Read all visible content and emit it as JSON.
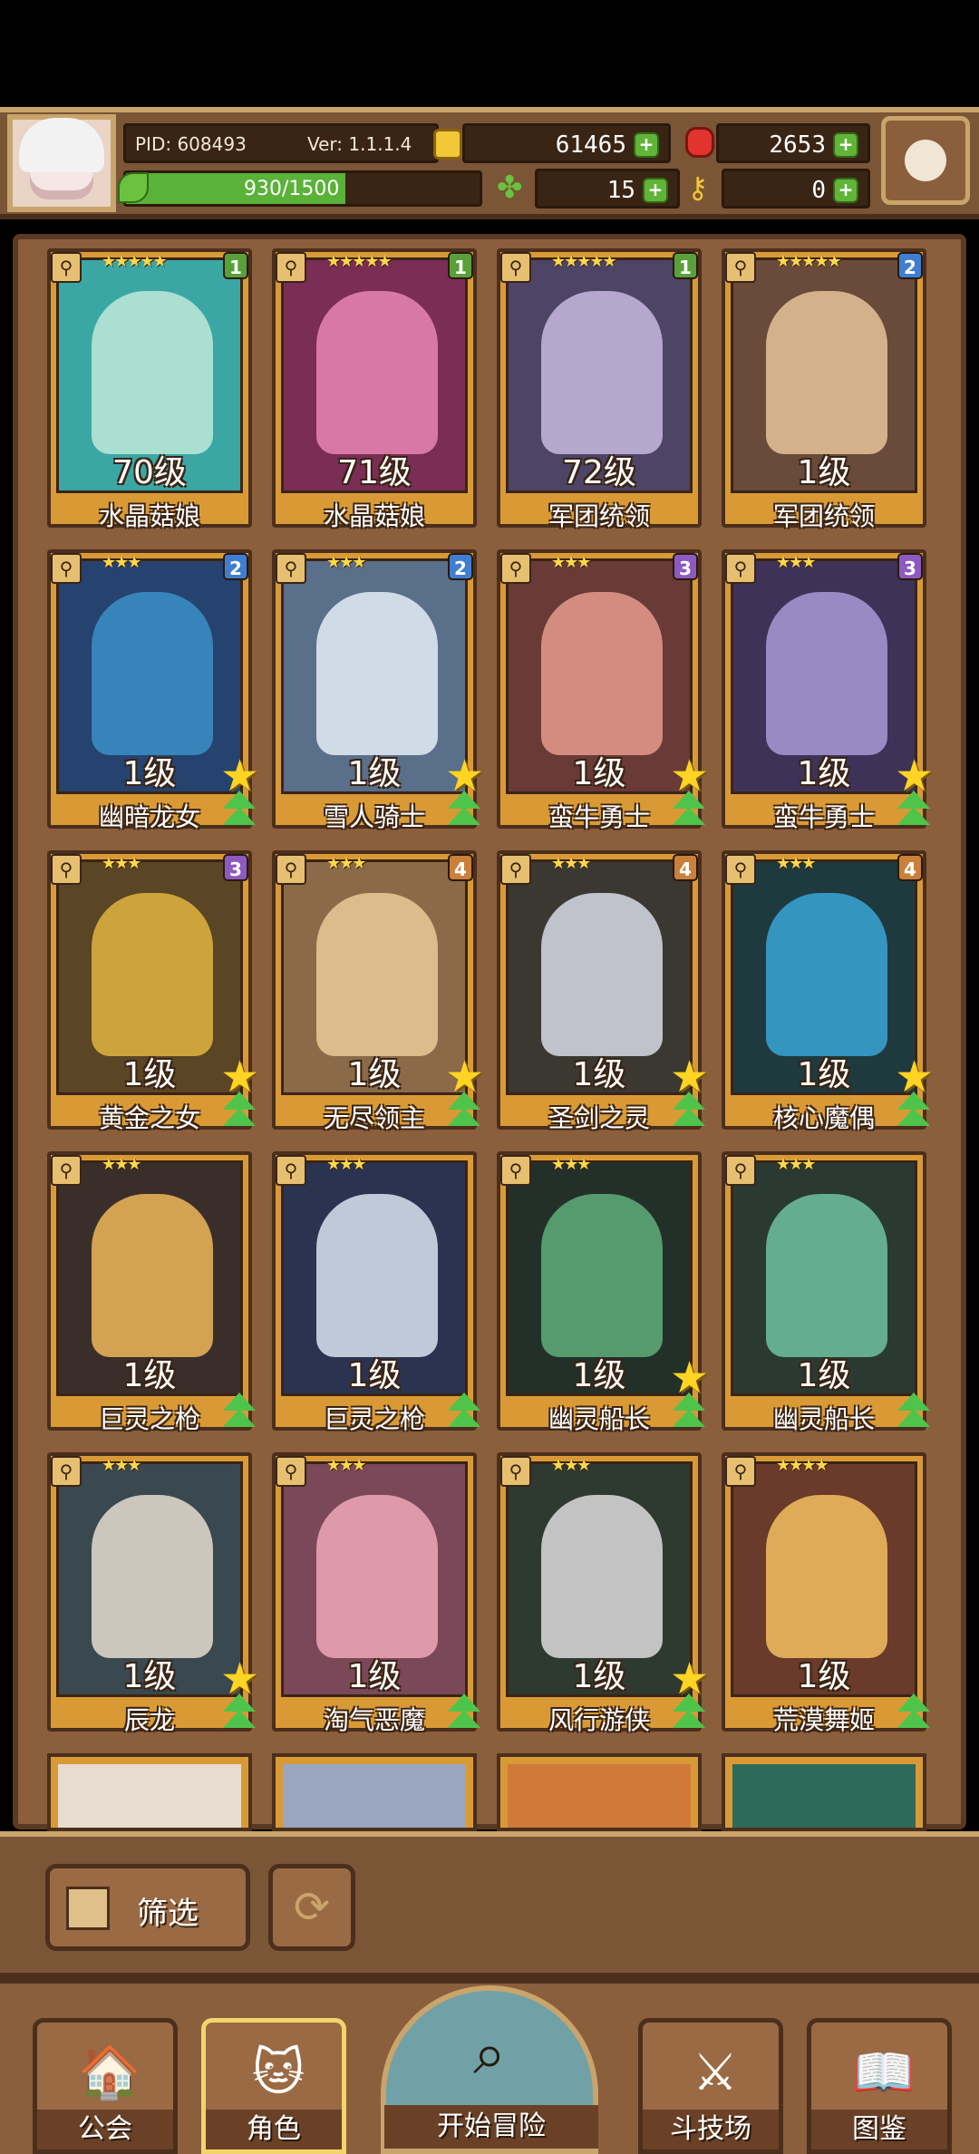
{
  "header": {
    "pid": "PID: 608493",
    "version": "Ver: 1.1.1.4",
    "gold": "61465",
    "gems": "2653",
    "exp": "930/1500",
    "exp_fraction": 0.62,
    "clover": "15",
    "key": "0"
  },
  "cards": [
    {
      "level": "70级",
      "name": "水晶菇娘",
      "stars": "★★★★★",
      "rank": "1",
      "rank_color": "#5aa03a",
      "bg": "#3aa7a5",
      "figure": "#bfe9d9",
      "star": false,
      "up": false
    },
    {
      "level": "71级",
      "name": "水晶菇娘",
      "stars": "★★★★★",
      "rank": "1",
      "rank_color": "#5aa03a",
      "bg": "#7a2d55",
      "figure": "#e887b3",
      "star": false,
      "up": false
    },
    {
      "level": "72级",
      "name": "军团统领",
      "stars": "★★★★★",
      "rank": "1",
      "rank_color": "#5aa03a",
      "bg": "#4d4466",
      "figure": "#c8b8e0",
      "star": false,
      "up": false
    },
    {
      "level": "1级",
      "name": "军团统领",
      "stars": "★★★★★",
      "rank": "2",
      "rank_color": "#3f7ed0",
      "bg": "#6a4a3a",
      "figure": "#e5c49a",
      "star": false,
      "up": false
    },
    {
      "level": "1级",
      "name": "幽暗龙女",
      "stars": "★★★",
      "rank": "2",
      "rank_color": "#3f7ed0",
      "bg": "#25436e",
      "figure": "#3a8fc8",
      "star": true,
      "up": true
    },
    {
      "level": "1级",
      "name": "雪人骑士",
      "stars": "★★★",
      "rank": "2",
      "rank_color": "#3f7ed0",
      "bg": "#5a6f8a",
      "figure": "#e4eef6",
      "star": true,
      "up": true
    },
    {
      "level": "1级",
      "name": "蛮牛勇士",
      "stars": "★★★",
      "rank": "3",
      "rank_color": "#8c5ac0",
      "bg": "#6a3a36",
      "figure": "#e69b8e",
      "star": true,
      "up": true
    },
    {
      "level": "1级",
      "name": "蛮牛勇士",
      "stars": "★★★",
      "rank": "3",
      "rank_color": "#8c5ac0",
      "bg": "#3e3258",
      "figure": "#a99ad6",
      "star": true,
      "up": true
    },
    {
      "level": "1级",
      "name": "黄金之女",
      "stars": "★★★",
      "rank": "3",
      "rank_color": "#8c5ac0",
      "bg": "#5a4524",
      "figure": "#e0b540",
      "star": true,
      "up": true
    },
    {
      "level": "1级",
      "name": "无尽领主",
      "stars": "★★★",
      "rank": "4",
      "rank_color": "#c9803a",
      "bg": "#8a6a48",
      "figure": "#e7cb98",
      "star": true,
      "up": true
    },
    {
      "level": "1级",
      "name": "圣剑之灵",
      "stars": "★★★",
      "rank": "4",
      "rank_color": "#c9803a",
      "bg": "#3a3830",
      "figure": "#d8dce6",
      "star": true,
      "up": true
    },
    {
      "level": "1级",
      "name": "核心魔偶",
      "stars": "★★★",
      "rank": "4",
      "rank_color": "#c9803a",
      "bg": "#1e3a3e",
      "figure": "#3aa6d8",
      "star": true,
      "up": true
    },
    {
      "level": "1级",
      "name": "巨灵之枪",
      "stars": "★★★",
      "rank": "",
      "rank_color": "",
      "bg": "#3a2e2a",
      "figure": "#f0b65a",
      "star": false,
      "up": true
    },
    {
      "level": "1级",
      "name": "巨灵之枪",
      "stars": "★★★",
      "rank": "",
      "rank_color": "",
      "bg": "#2a3450",
      "figure": "#dbe4f0",
      "star": false,
      "up": true
    },
    {
      "level": "1级",
      "name": "幽灵船长",
      "stars": "★★★",
      "rank": "",
      "rank_color": "",
      "bg": "#23302a",
      "figure": "#5fae7a",
      "star": true,
      "up": true
    },
    {
      "level": "1级",
      "name": "幽灵船长",
      "stars": "★★★",
      "rank": "",
      "rank_color": "",
      "bg": "#2a3a32",
      "figure": "#6fc2a2",
      "star": false,
      "up": true
    },
    {
      "level": "1级",
      "name": "辰龙",
      "stars": "★★★",
      "rank": "",
      "rank_color": "",
      "bg": "#3a4850",
      "figure": "#e6ddd0",
      "star": true,
      "up": true
    },
    {
      "level": "1级",
      "name": "淘气恶魔",
      "stars": "★★★",
      "rank": "",
      "rank_color": "",
      "bg": "#7a4858",
      "figure": "#f0a8b8",
      "star": false,
      "up": true
    },
    {
      "level": "1级",
      "name": "风行游侠",
      "stars": "★★★",
      "rank": "",
      "rank_color": "",
      "bg": "#2e3a30",
      "figure": "#dcdcdc",
      "star": true,
      "up": true
    },
    {
      "level": "1级",
      "name": "荒漠舞姬",
      "stars": "★★★★",
      "rank": "",
      "rank_color": "",
      "bg": "#6a3a2a",
      "figure": "#f2c060",
      "star": false,
      "up": true
    }
  ],
  "filter": {
    "label": "筛选"
  },
  "nav": {
    "guild": "公会",
    "character": "角色",
    "adventure": "开始冒险",
    "arena": "斗技场",
    "codex": "图鉴"
  },
  "colors": {
    "frame_gold": "#d99a36",
    "panel_brown": "#8b5e3c",
    "plus_green": "#62b438"
  }
}
